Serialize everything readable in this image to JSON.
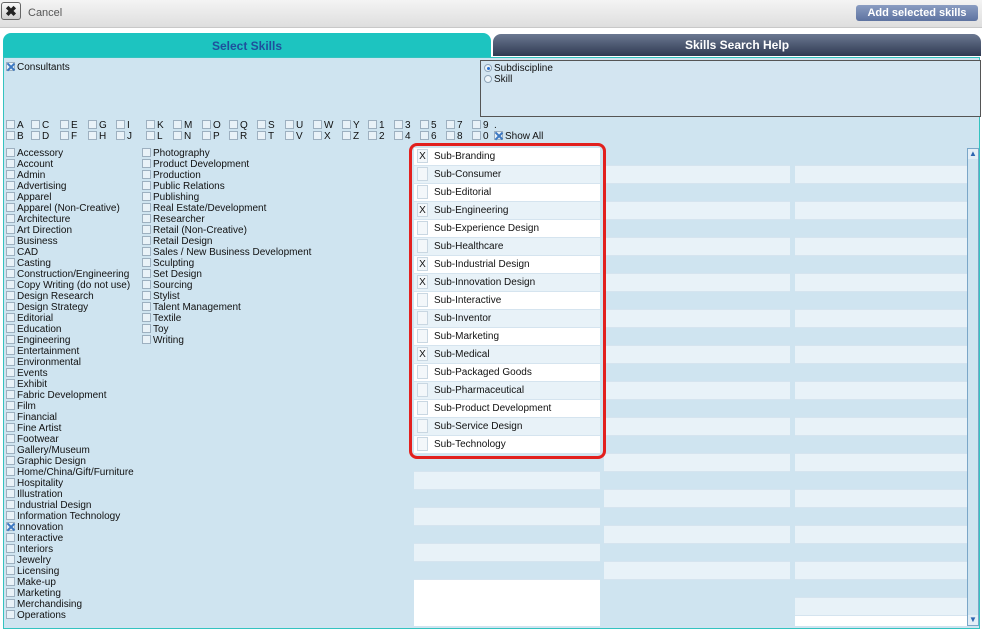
{
  "topbar": {
    "cancel_label": "Cancel",
    "add_label": "Add selected skills"
  },
  "tabs": {
    "select": "Select Skills",
    "help": "Skills Search Help"
  },
  "consultants_label": "Consultants",
  "search_mode": {
    "options": [
      "Subdiscipline",
      "Skill"
    ],
    "selected": "Subdiscipline"
  },
  "alphabet": {
    "row1": [
      "A",
      "C",
      "E",
      "G",
      "I",
      "K",
      "M",
      "O",
      "Q",
      "S",
      "U",
      "W",
      "Y",
      "1",
      "3",
      "5",
      "7",
      "9",
      "."
    ],
    "row2": [
      "B",
      "D",
      "F",
      "H",
      "J",
      "L",
      "N",
      "P",
      "R",
      "T",
      "V",
      "X",
      "Z",
      "2",
      "4",
      "6",
      "8",
      "0",
      "Show All"
    ]
  },
  "skills_col1": [
    "Accessory",
    "Account",
    "Admin",
    "Advertising",
    "Apparel",
    "Apparel (Non-Creative)",
    "Architecture",
    "Art Direction",
    "Business",
    "CAD",
    "Casting",
    "Construction/Engineering",
    "Copy Writing (do not use)",
    "Design Research",
    "Design Strategy",
    "Editorial",
    "Education",
    "Engineering",
    "Entertainment",
    "Environmental",
    "Events",
    "Exhibit",
    "Fabric Development",
    "Film",
    "Financial",
    "Fine Artist",
    "Footwear",
    "Gallery/Museum",
    "Graphic Design",
    "Home/China/Gift/Furniture",
    "Hospitality",
    "Illustration",
    "Industrial Design",
    "Information Technology",
    "Innovation",
    "Interactive",
    "Interiors",
    "Jewelry",
    "Licensing",
    "Make-up",
    "Marketing",
    "Merchandising",
    "Operations"
  ],
  "skills_col1_checked": [
    "Innovation"
  ],
  "skills_col2": [
    "Photography",
    "Product Development",
    "Production",
    "Public Relations",
    "Publishing",
    "Real Estate/Development",
    "Researcher",
    "Retail  (Non-Creative)",
    "Retail Design",
    "Sales / New Business Development",
    "Sculpting",
    "Set Design",
    "Sourcing",
    "Stylist",
    "Talent Management",
    "Textile",
    "Toy",
    "Writing"
  ],
  "subdisciplines": [
    {
      "label": "Sub-Branding",
      "checked": true
    },
    {
      "label": "Sub-Consumer",
      "checked": false
    },
    {
      "label": "Sub-Editorial",
      "checked": false
    },
    {
      "label": "Sub-Engineering",
      "checked": true
    },
    {
      "label": "Sub-Experience Design",
      "checked": false
    },
    {
      "label": "Sub-Healthcare",
      "checked": false
    },
    {
      "label": "Sub-Industrial Design",
      "checked": true
    },
    {
      "label": "Sub-Innovation Design",
      "checked": true
    },
    {
      "label": "Sub-Interactive",
      "checked": false
    },
    {
      "label": "Sub-Inventor",
      "checked": false
    },
    {
      "label": "Sub-Marketing",
      "checked": false
    },
    {
      "label": "Sub-Medical",
      "checked": true
    },
    {
      "label": "Sub-Packaged Goods",
      "checked": false
    },
    {
      "label": "Sub-Pharmaceutical",
      "checked": false
    },
    {
      "label": "Sub-Product Development",
      "checked": false
    },
    {
      "label": "Sub-Service Design",
      "checked": false
    },
    {
      "label": "Sub-Technology",
      "checked": false
    }
  ],
  "check_mark": "X",
  "icons": {
    "cancel": "close-icon",
    "scroll_up": "arrow-up-icon",
    "scroll_down": "arrow-down-icon"
  },
  "colors": {
    "tab_active": "#1dc4c0",
    "tab_inactive": "#3a4660",
    "panel": "#cfe4f0",
    "highlight": "#e2201e",
    "add_button": "#6a7fae"
  }
}
